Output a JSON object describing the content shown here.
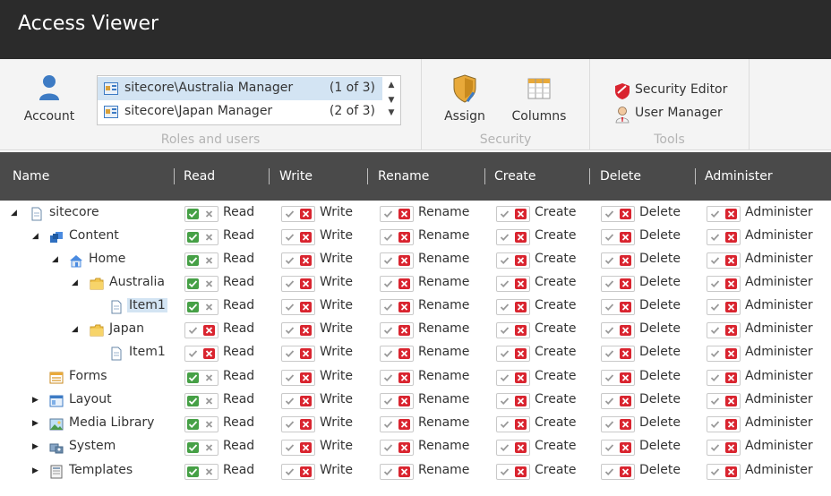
{
  "app": {
    "title": "Access Viewer"
  },
  "ribbon": {
    "account_label": "Account",
    "roles": [
      {
        "name": "sitecore\\Australia Manager",
        "count": "(1 of 3)",
        "selected": true
      },
      {
        "name": "sitecore\\Japan Manager",
        "count": "(2 of 3)",
        "selected": false
      }
    ],
    "roles_group_label": "Roles and users",
    "assign_label": "Assign",
    "columns_label": "Columns",
    "security_group_label": "Security",
    "security_editor_label": "Security Editor",
    "user_manager_label": "User Manager",
    "tools_group_label": "Tools",
    "scroll_up": "▲",
    "scroll_down": "▼"
  },
  "grid": {
    "columns": [
      "Name",
      "Read",
      "Write",
      "Rename",
      "Create",
      "Delete",
      "Administer"
    ],
    "rows": [
      {
        "name": "sitecore",
        "level": 0,
        "arrow": "◢",
        "icon": "page-icon",
        "selected": false,
        "read": "allow"
      },
      {
        "name": "Content",
        "level": 1,
        "arrow": "◢",
        "icon": "content-icon",
        "selected": false,
        "read": "allow"
      },
      {
        "name": "Home",
        "level": 2,
        "arrow": "◢",
        "icon": "home-icon",
        "selected": false,
        "read": "allow"
      },
      {
        "name": "Australia",
        "level": 3,
        "arrow": "◢",
        "icon": "folder-icon",
        "selected": false,
        "read": "allow"
      },
      {
        "name": "Item1",
        "level": 4,
        "arrow": "",
        "icon": "page-icon",
        "selected": true,
        "read": "allow"
      },
      {
        "name": "Japan",
        "level": 3,
        "arrow": "◢",
        "icon": "folder-icon",
        "selected": false,
        "read": "deny"
      },
      {
        "name": "Item1",
        "level": 4,
        "arrow": "",
        "icon": "page-icon",
        "selected": false,
        "read": "deny"
      },
      {
        "name": "Forms",
        "level": 1,
        "arrow": "",
        "icon": "forms-icon",
        "selected": false,
        "read": "allow"
      },
      {
        "name": "Layout",
        "level": 1,
        "arrow": "▶",
        "icon": "layout-icon",
        "selected": false,
        "read": "allow"
      },
      {
        "name": "Media Library",
        "level": 1,
        "arrow": "▶",
        "icon": "media-icon",
        "selected": false,
        "read": "allow"
      },
      {
        "name": "System",
        "level": 1,
        "arrow": "▶",
        "icon": "system-icon",
        "selected": false,
        "read": "allow"
      },
      {
        "name": "Templates",
        "level": 1,
        "arrow": "▶",
        "icon": "templates-icon",
        "selected": false,
        "read": "allow"
      }
    ]
  },
  "colors": {
    "titlebar": "#2b2b2b",
    "header": "#4a4a4a",
    "allow": "#46a046",
    "deny": "#d9242f",
    "selection": "#d3e4f3"
  }
}
